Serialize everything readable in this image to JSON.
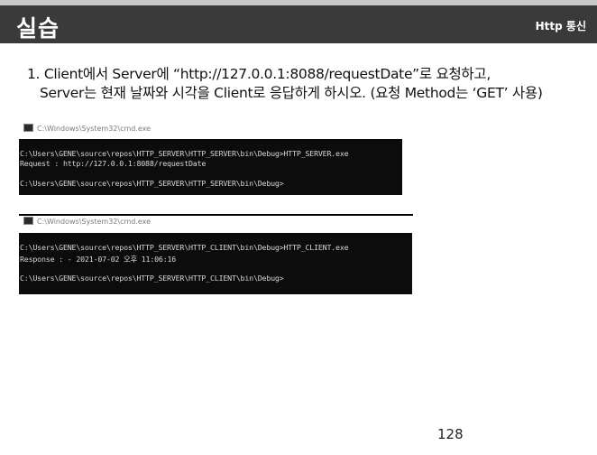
{
  "header": {
    "title": "실습",
    "section": "Http 통신"
  },
  "question": {
    "line1": "1. Client에서 Server에 “http://127.0.0.1:8088/requestDate”로 요청하고,",
    "line2": "Server는 현재 날짜와 시각을 Client로 응답하게 하시오. (요청 Method는 ‘GET’ 사용)"
  },
  "console1": {
    "title": "C:\\Windows\\System32\\cmd.exe",
    "lines": [
      "C:\\Users\\GENE\\source\\repos\\HTTP_SERVER\\HTTP_SERVER\\bin\\Debug>HTTP_SERVER.exe",
      "Request : http://127.0.0.1:8088/requestDate",
      "C:\\Users\\GENE\\source\\repos\\HTTP_SERVER\\HTTP_SERVER\\bin\\Debug>"
    ]
  },
  "console2": {
    "title": "C:\\Windows\\System32\\cmd.exe",
    "lines": [
      "C:\\Users\\GENE\\source\\repos\\HTTP_SERVER\\HTTP_CLIENT\\bin\\Debug>HTTP_CLIENT.exe",
      "Response : - 2021-07-02 오후 11:06:16",
      "C:\\Users\\GENE\\source\\repos\\HTTP_SERVER\\HTTP_CLIENT\\bin\\Debug>"
    ]
  },
  "page_number": "128",
  "icons": {
    "console_icon": "cmd-window-icon"
  }
}
